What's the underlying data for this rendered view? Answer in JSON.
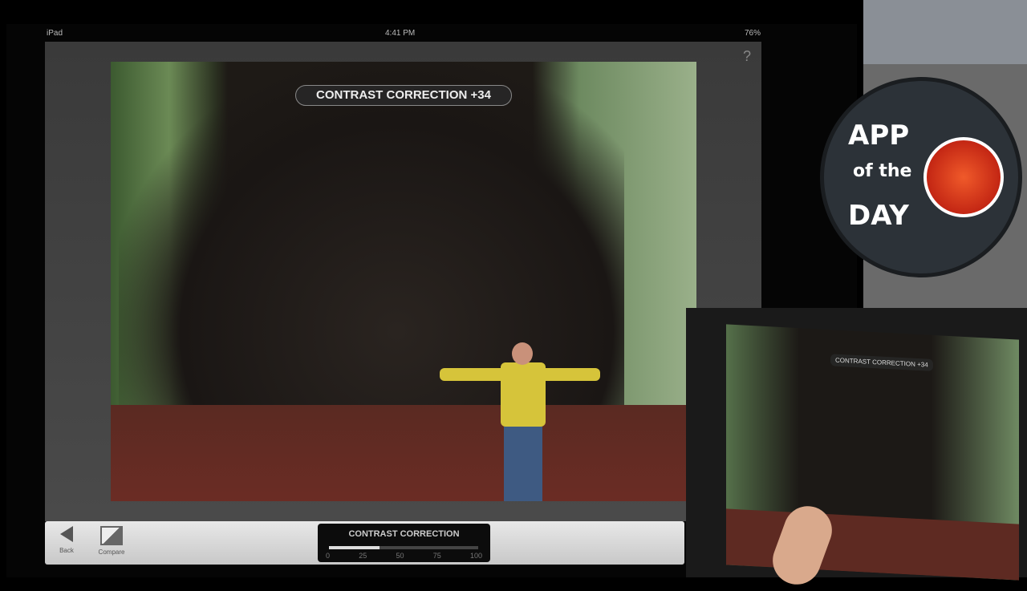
{
  "status_bar": {
    "device": "iPad",
    "time": "4:41 PM",
    "battery": "76%"
  },
  "help_label": "?",
  "overlay_badge": "CONTRAST CORRECTION +34",
  "toolbar": {
    "back_label": "Back",
    "compare_label": "Compare"
  },
  "slider": {
    "title": "CONTRAST CORRECTION",
    "value": 34,
    "ticks": [
      "0",
      "25",
      "50",
      "75",
      "100"
    ]
  },
  "logo": {
    "line1": "APP",
    "line2": "of the",
    "line3": "DAY"
  },
  "inset": {
    "badge": "CONTRAST CORRECTION +34"
  }
}
